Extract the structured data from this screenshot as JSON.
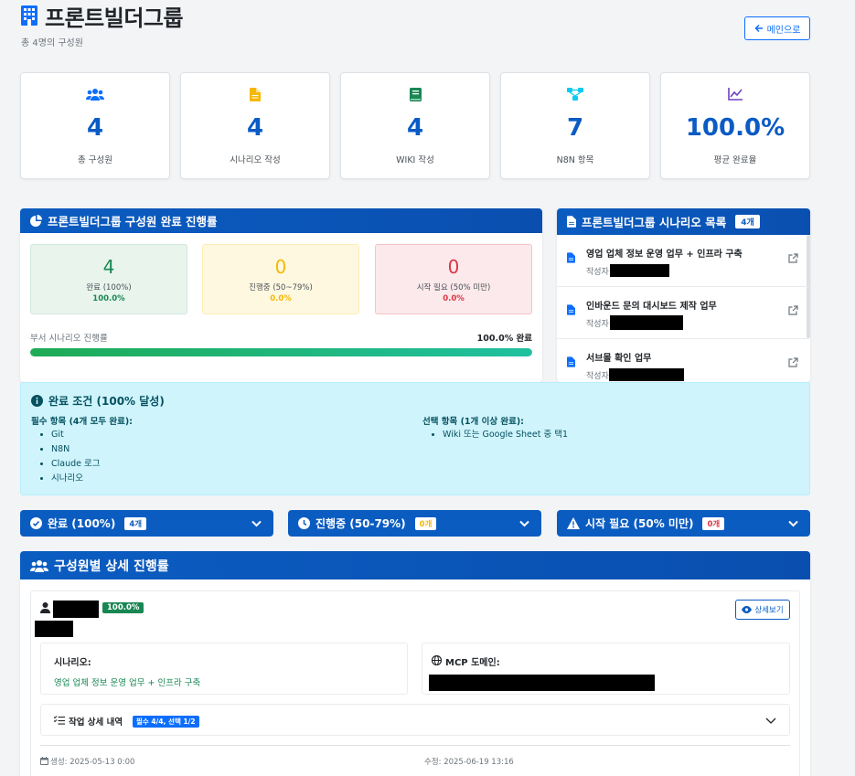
{
  "header": {
    "title": "프론트빌더그룹",
    "subtitle": "총 4명의 구성원",
    "back_button": "메인으로"
  },
  "stats": [
    {
      "icon": "users-icon",
      "value": "4",
      "label": "총 구성원",
      "color": "#0d6efd"
    },
    {
      "icon": "file-icon",
      "value": "4",
      "label": "시나리오 작성",
      "color": "#f5b800"
    },
    {
      "icon": "book-icon",
      "value": "4",
      "label": "WIKI 작성",
      "color": "#198754"
    },
    {
      "icon": "network-icon",
      "value": "7",
      "label": "N8N 항목",
      "color": "#0dcaf0"
    },
    {
      "icon": "chart-line-icon",
      "value": "100.0%",
      "label": "평균 완료율",
      "color": "#6f42c1"
    }
  ],
  "progress_panel": {
    "title": "프론트빌더그룹 구성원 완료 진행률",
    "boxes": [
      {
        "value": "4",
        "label": "완료 (100%)",
        "percent": "100.0%"
      },
      {
        "value": "0",
        "label": "진행중 (50~79%)",
        "percent": "0.0%"
      },
      {
        "value": "0",
        "label": "시작 필요 (50% 미만)",
        "percent": "0.0%"
      }
    ],
    "bar_label": "부서 시나리오 진행률",
    "bar_value_text": "100.0% 완료",
    "bar_fraction": 1.0
  },
  "scenario_panel": {
    "title": "프론트빌더그룹 시나리오 목록",
    "count": "4개",
    "author_label": "작성자:",
    "items": [
      {
        "title": "영업 업체 정보 운영 업무 + 인프라 구축"
      },
      {
        "title": "인바운드 문의 대시보드 제작 업무"
      },
      {
        "title": "서브몰 확인 업무"
      }
    ]
  },
  "conditions": {
    "title": "완료 조건 (100% 달성)",
    "required_title": "필수 항목 (4개 모두 완료):",
    "required_items": [
      "Git",
      "N8N",
      "Claude 로그",
      "시나리오"
    ],
    "optional_title": "선택 항목 (1개 이상 완료):",
    "optional_items": [
      "Wiki 또는 Google Sheet 중 택1"
    ]
  },
  "collapsibles": [
    {
      "label": "완료 (100%)",
      "badge": "4개",
      "badge_color": "#0b5cc1"
    },
    {
      "label": "진행중 (50-79%)",
      "badge": "0개",
      "badge_color": "#f5b800"
    },
    {
      "label": "시작 필요 (50% 미만)",
      "badge": "0개",
      "badge_color": "#dc3545"
    }
  ],
  "members": {
    "title": "구성원별 상세 진행률",
    "member": {
      "percent_badge": "100.0%",
      "detail_button": "상세보기",
      "scenario_label": "시나리오:",
      "scenario_value": "영업 업체 정보 운영 업무 + 인프라 구축",
      "mcp_label": "MCP 도메인:",
      "task_label": "작업 상세 내역",
      "task_badge": "필수 4/4, 선택 1/2",
      "created": "생성: 2025-05-13 0:00",
      "modified": "수정: 2025-06-19 13:16"
    }
  }
}
